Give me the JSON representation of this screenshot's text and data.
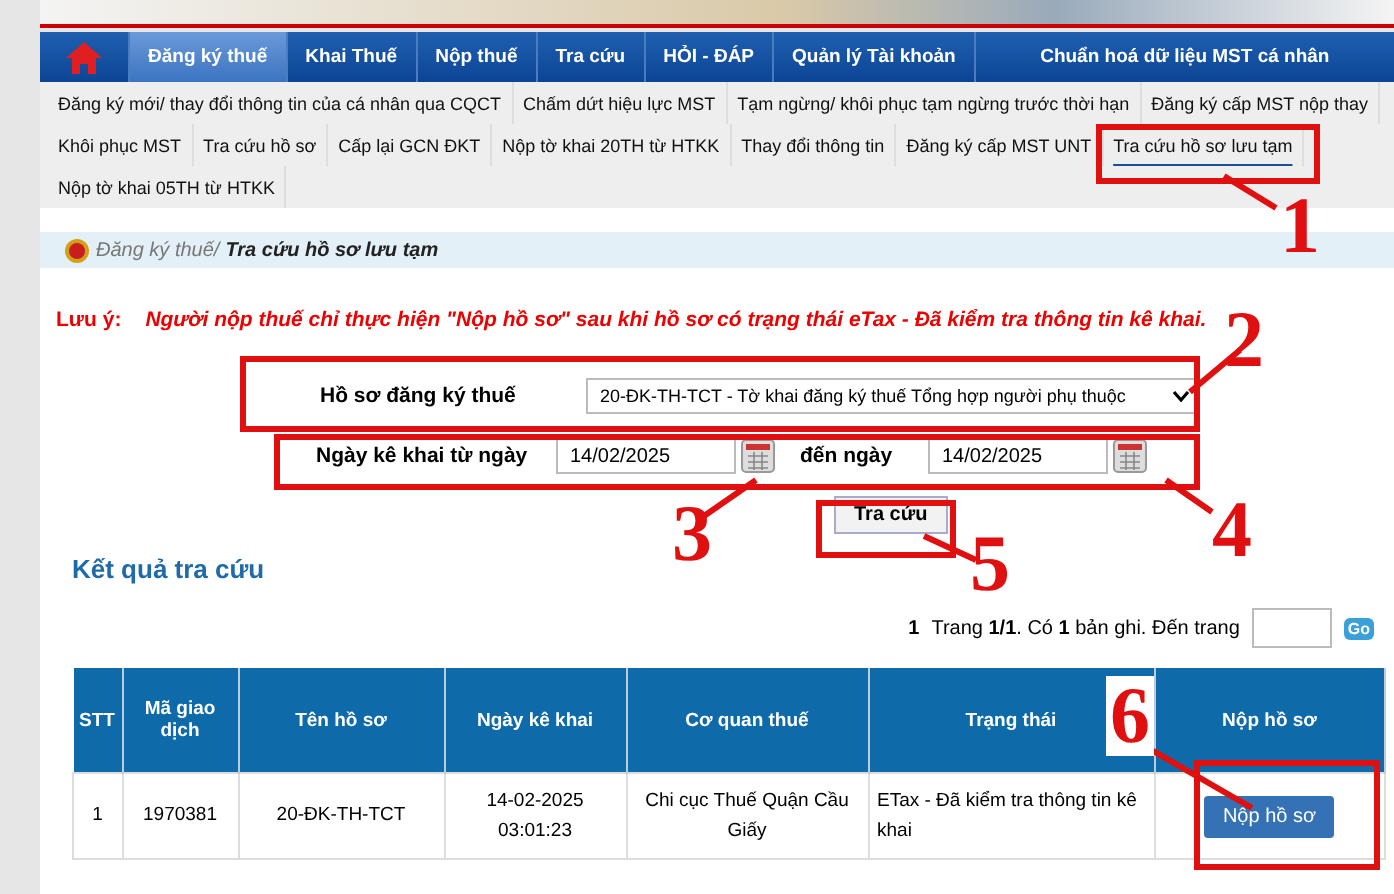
{
  "nav": {
    "items": [
      {
        "label": "Đăng ký thuế",
        "selected": true
      },
      {
        "label": "Khai Thuế",
        "selected": false
      },
      {
        "label": "Nộp thuế",
        "selected": false
      },
      {
        "label": "Tra cứu",
        "selected": false
      },
      {
        "label": "HỎI - ĐÁP",
        "selected": false
      },
      {
        "label": "Quản lý Tài khoản",
        "selected": false
      },
      {
        "label": "Chuẩn hoá dữ liệu MST cá nhân",
        "selected": false
      }
    ]
  },
  "submenu": {
    "items": [
      {
        "label": "Đăng ký mới/ thay đổi thông tin của cá nhân qua CQCT",
        "selected": false
      },
      {
        "label": "Chấm dứt hiệu lực MST",
        "selected": false
      },
      {
        "label": "Tạm ngừng/ khôi phục tạm ngừng trước thời hạn",
        "selected": false
      },
      {
        "label": "Đăng ký cấp MST nộp thay",
        "selected": false
      },
      {
        "label": "Khôi phục MST",
        "selected": false
      },
      {
        "label": "Tra cứu hồ sơ",
        "selected": false
      },
      {
        "label": "Cấp lại GCN ĐKT",
        "selected": false
      },
      {
        "label": "Nộp tờ khai 20TH từ HTKK",
        "selected": false
      },
      {
        "label": "Thay đổi thông tin",
        "selected": false
      },
      {
        "label": "Đăng ký cấp MST UNT",
        "selected": false
      },
      {
        "label": "Tra cứu hồ sơ lưu tạm",
        "selected": true
      },
      {
        "label": "Nộp tờ khai 05TH từ HTKK",
        "selected": false
      }
    ]
  },
  "breadcrumb": {
    "parent": "Đăng ký thuế/",
    "current": "Tra cứu hồ sơ lưu tạm"
  },
  "note": {
    "label": "Lưu ý:",
    "text": "Người nộp thuế chỉ thực hiện \"Nộp hồ sơ\" sau khi hồ sơ có trạng thái eTax - Đã kiểm tra thông tin kê khai."
  },
  "form": {
    "dossier_label": "Hồ sơ đăng ký thuế",
    "dossier_value": "20-ĐK-TH-TCT - Tờ khai đăng ký thuế Tổng hợp người phụ thuộc",
    "date_from_label": "Ngày kê khai từ ngày",
    "date_from": "14/02/2025",
    "date_to_label": "đến ngày",
    "date_to": "14/02/2025",
    "search_button": "Tra cứu"
  },
  "results": {
    "title": "Kết quả tra cứu",
    "pager": {
      "page": "1",
      "text": "Trang **1/1**. Có **1** bản ghi. Đến trang",
      "go": "Go"
    },
    "table": {
      "columns": [
        "STT",
        "Mã giao dịch",
        "Tên hồ sơ",
        "Ngày kê khai",
        "Cơ quan thuế",
        "Trạng thái",
        "Nộp hồ sơ"
      ],
      "rows": [
        {
          "stt": "1",
          "code": "1970381",
          "name": "20-ĐK-TH-TCT",
          "date": "14-02-2025 03:01:23",
          "office": "Chi cục Thuế Quận Cầu Giấy",
          "status": "ETax - Đã kiểm tra thông tin kê khai",
          "action": "Nộp hồ sơ"
        }
      ]
    }
  },
  "annotations": [
    "1",
    "2",
    "3",
    "4",
    "5",
    "6"
  ]
}
